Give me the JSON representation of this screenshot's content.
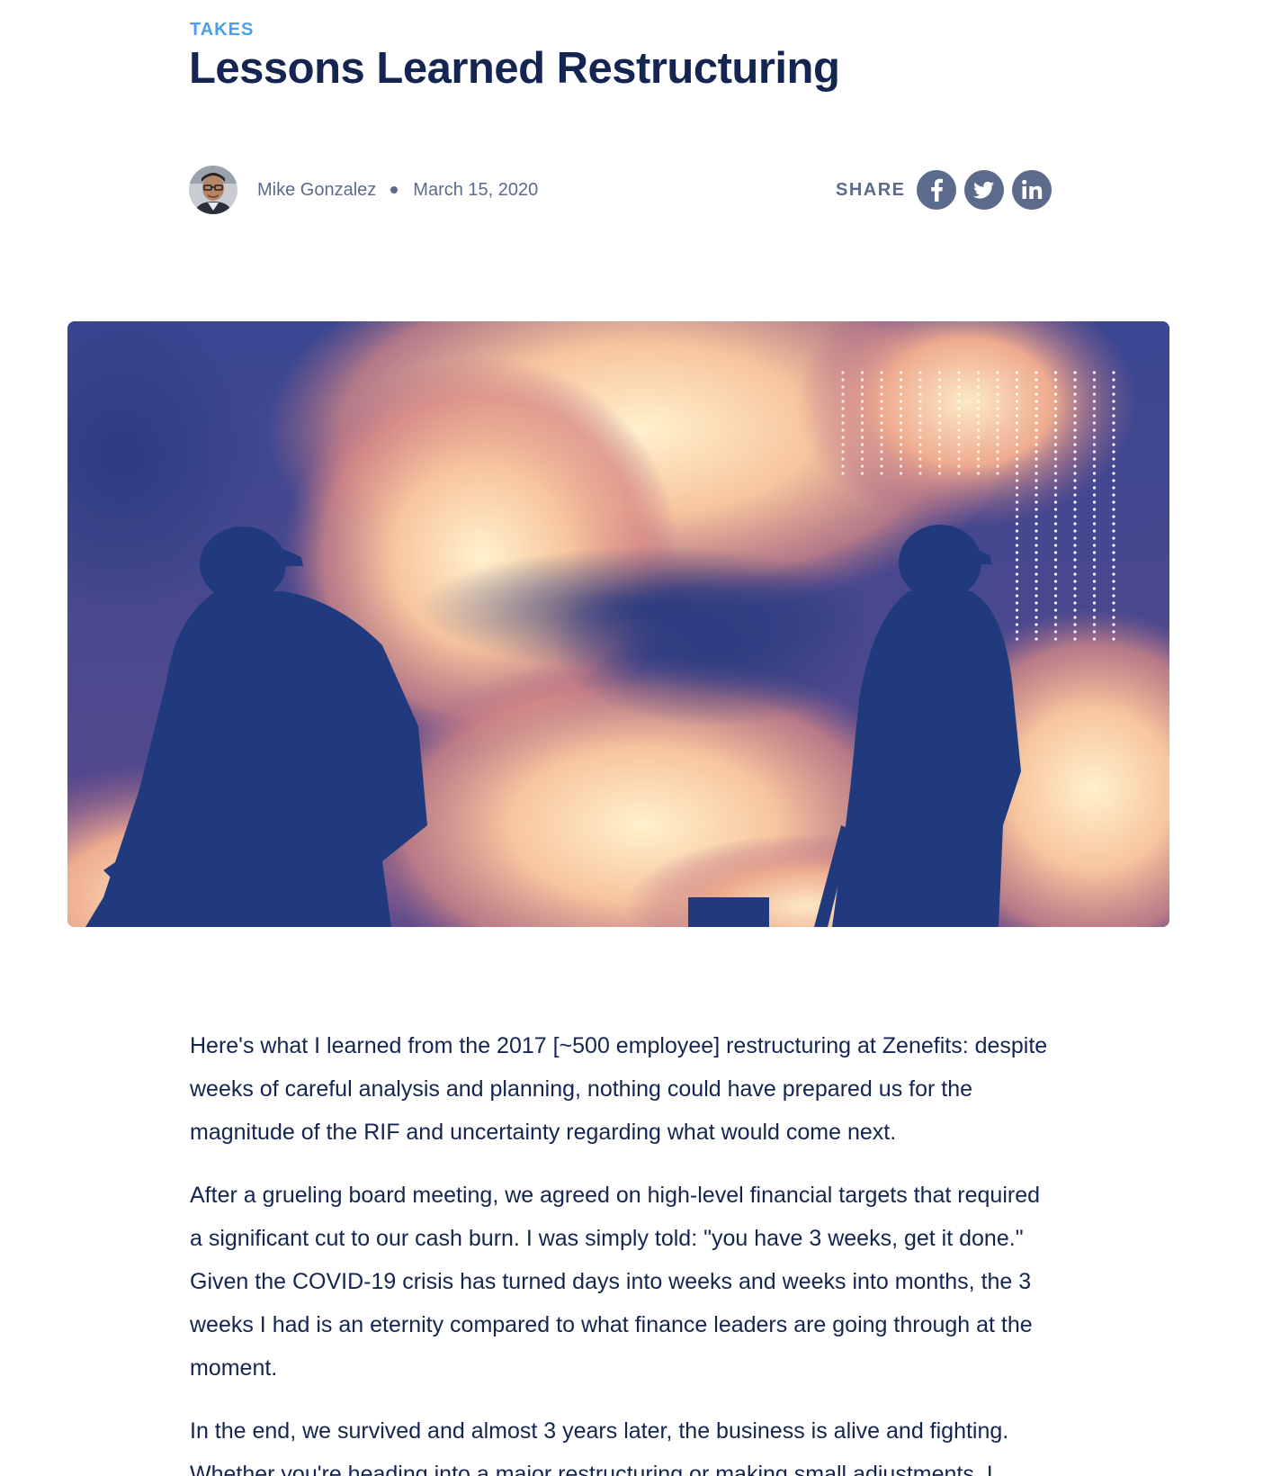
{
  "post": {
    "category": "TAKES",
    "title": "Lessons Learned Restructuring"
  },
  "byline": {
    "author": "Mike Gonzalez",
    "date": "March 15, 2020"
  },
  "share": {
    "label": "SHARE",
    "icons": [
      "facebook-icon",
      "twitter-icon",
      "linkedin-icon"
    ]
  },
  "hero_image": {
    "subject": "two firefighter silhouettes against flames, duotone navy and peach"
  },
  "article": {
    "paragraphs": [
      "Here's what I learned from the 2017 [~500 employee] restructuring at Zenefits: despite weeks of careful analysis and planning, nothing could have prepared us for the magnitude of the RIF and uncertainty regarding what would come next.",
      "After a grueling board meeting, we agreed on high-level financial targets that required a significant cut to our cash burn. I was simply told: \"you have 3 weeks, get it done.\" Given the COVID-19 crisis has turned days into weeks and weeks into months, the 3 weeks I had is an eternity compared to what finance leaders are going through at the moment.",
      "In the end, we survived and almost 3 years later, the business is alive and fighting. Whether you're heading into a major restructuring or making small adjustments, I"
    ]
  },
  "colors": {
    "accent": "#4a9ff0",
    "title": "#152551",
    "muted": "#5c6a8c",
    "hero_dark": "#2e3f86",
    "hero_light": "#fce7c1"
  }
}
